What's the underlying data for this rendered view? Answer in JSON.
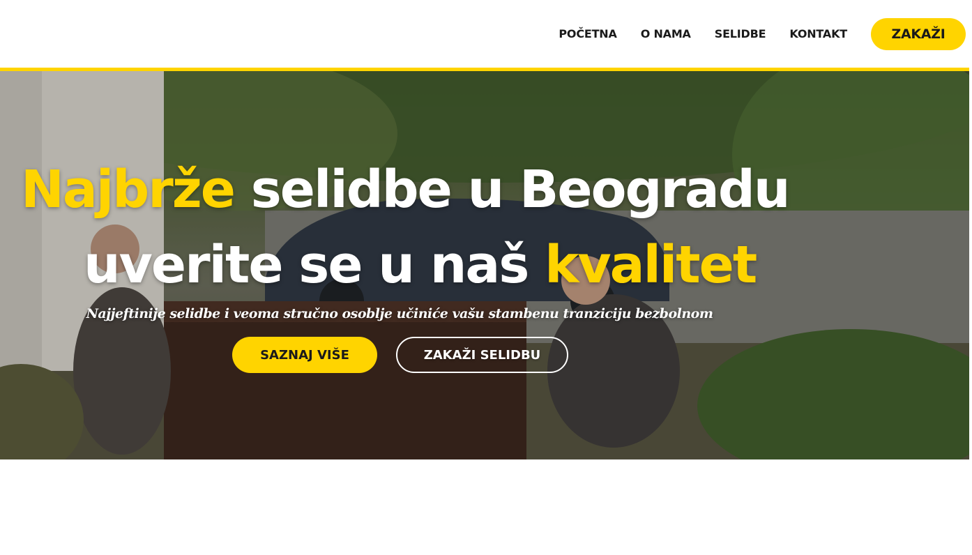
{
  "nav": {
    "items": [
      {
        "label": "POČETNA"
      },
      {
        "label": "O NAMA"
      },
      {
        "label": "SELIDBE"
      },
      {
        "label": "KONTAKT"
      }
    ],
    "cta_label": "ZAKAŽI"
  },
  "hero": {
    "line1_highlight": "Najbrže",
    "line1_rest": " selidbe u Beogradu",
    "line2_rest": "uverite se u naš ",
    "line2_highlight": "kvalitet",
    "subtext": "Najjeftinije selidbe i veoma stručno osoblje učiniće vašu stambenu tranziciju bezbolnom",
    "primary_button": "SAZNAJ VIŠE",
    "secondary_button": "ZAKAŽI SELIDBU"
  },
  "colors": {
    "accent": "#ffd400",
    "text_dark": "#1a1a1a",
    "text_light": "#ffffff"
  }
}
